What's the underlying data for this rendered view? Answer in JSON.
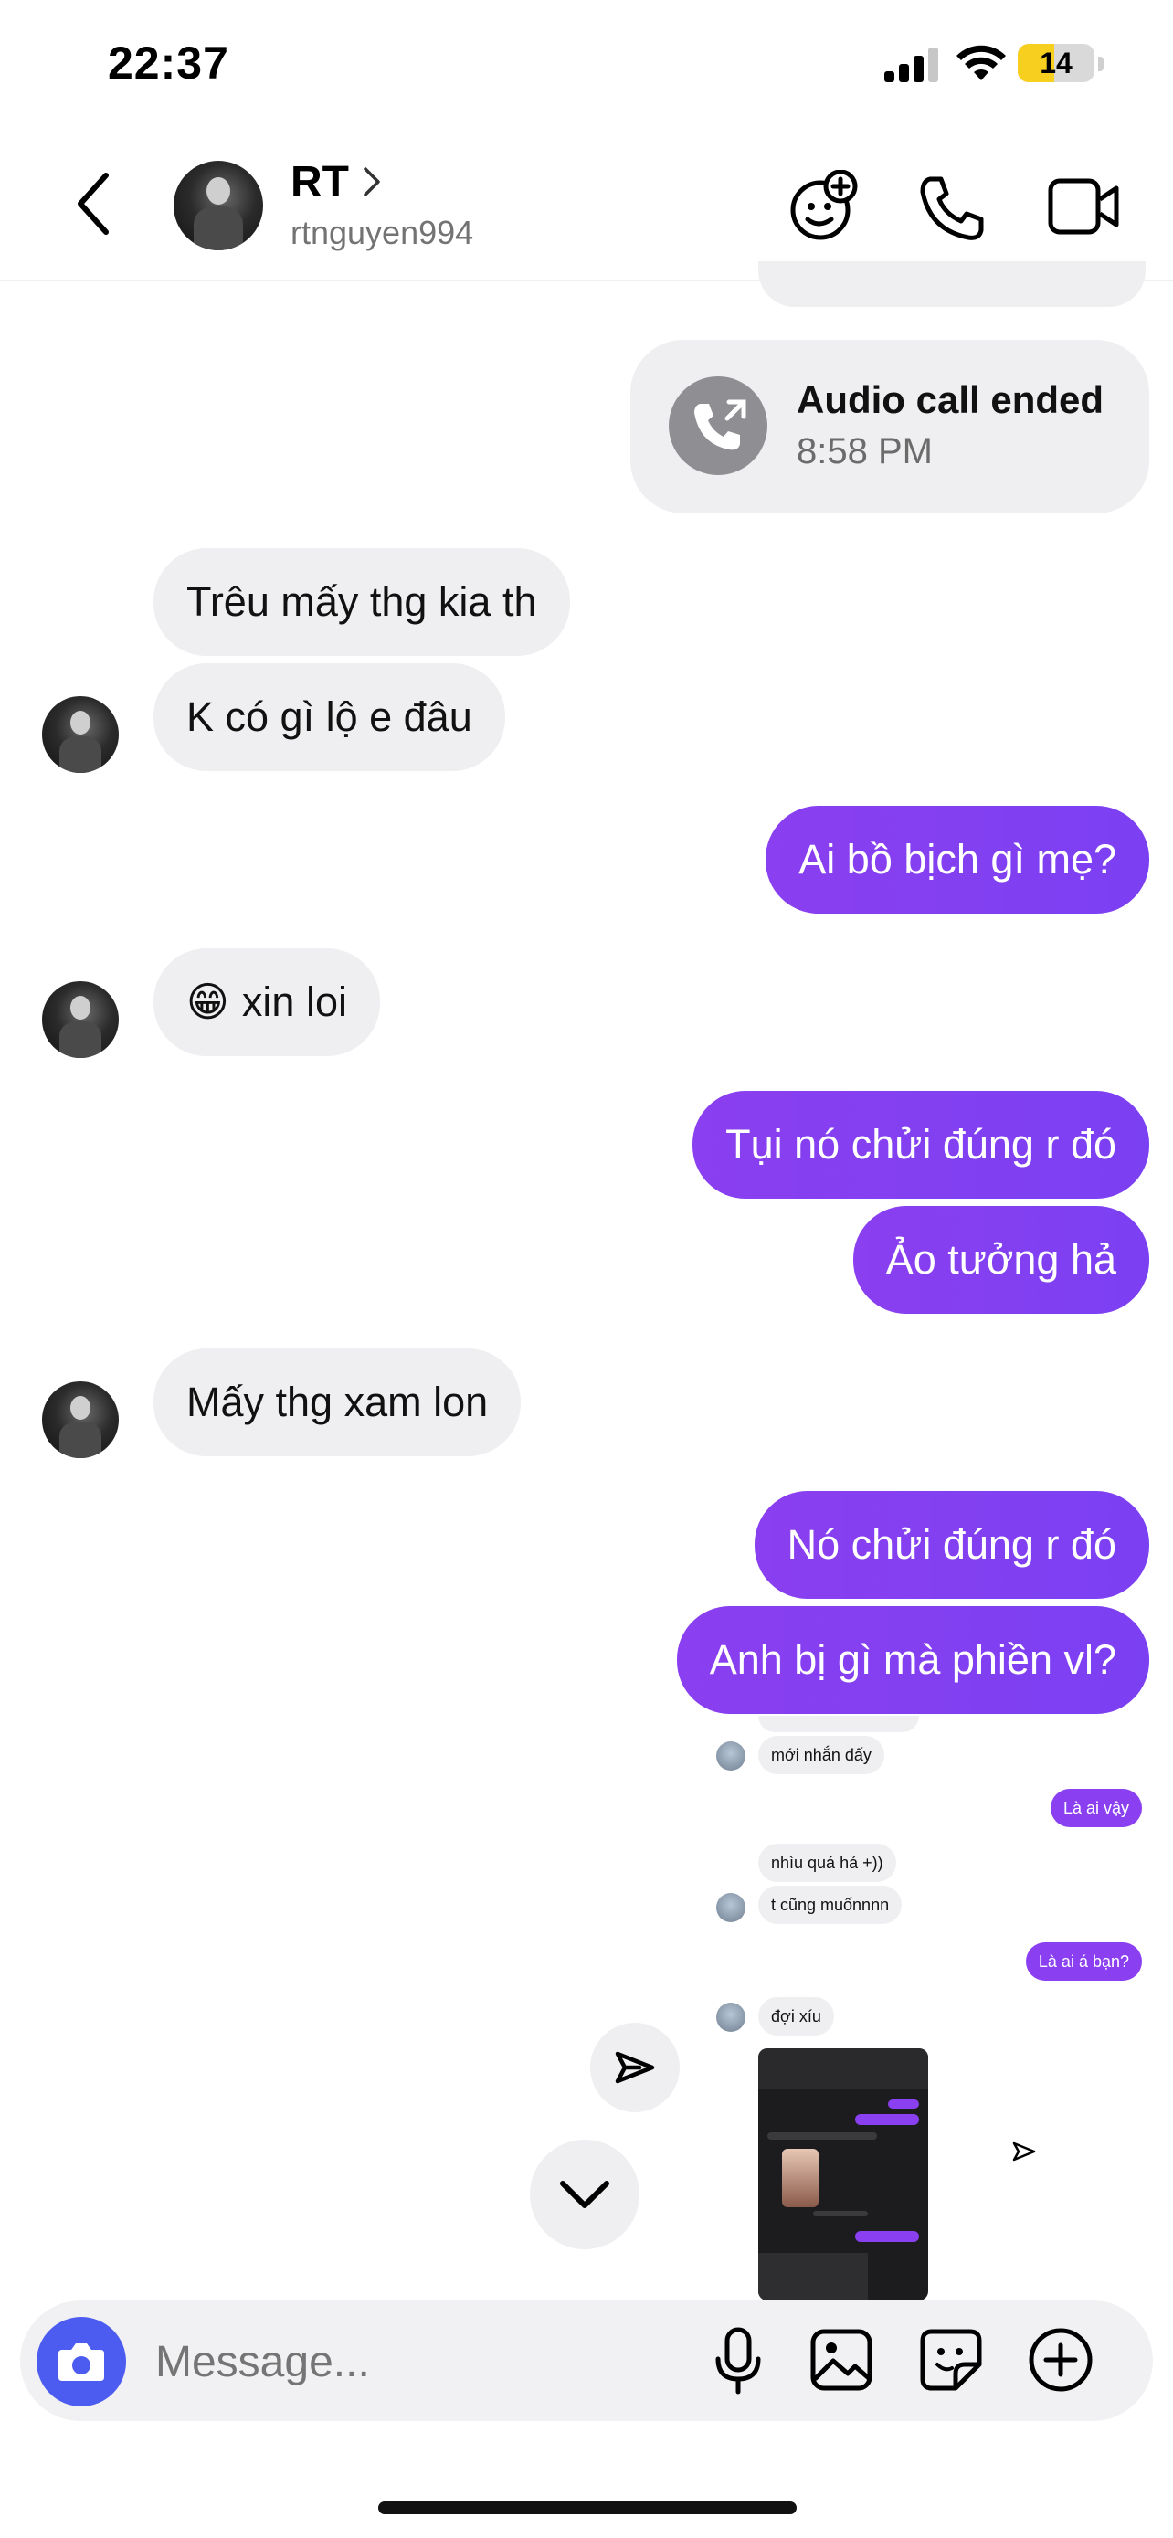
{
  "status_bar": {
    "time": "22:37",
    "battery": "14"
  },
  "header": {
    "name": "RT",
    "username": "rtnguyen994"
  },
  "call_card": {
    "title": "Audio call ended",
    "time": "8:58 PM"
  },
  "messages": [
    {
      "dir": "in",
      "text": "Trêu mấy thg kia th"
    },
    {
      "dir": "in",
      "text": "K có gì lộ e đâu"
    },
    {
      "dir": "out",
      "text": "Ai bồ bịch gì mẹ?"
    },
    {
      "dir": "in",
      "emoji": "😁",
      "text": "xin loi"
    },
    {
      "dir": "out",
      "text": "Tụi nó chửi đúng r đó"
    },
    {
      "dir": "out",
      "text": "Ảo tưởng hả"
    },
    {
      "dir": "in",
      "text": "Mấy thg xam lon"
    },
    {
      "dir": "out",
      "text": "Nó chửi đúng r đó"
    },
    {
      "dir": "out",
      "text": "Anh bị gì mà phiền vl?"
    }
  ],
  "shared_screenshot": {
    "items": [
      {
        "dir": "in",
        "text": "mới nhắn đấy"
      },
      {
        "dir": "out",
        "text": "Là ai vậy"
      },
      {
        "dir": "in",
        "text": "nhìu quá hả +))"
      },
      {
        "dir": "in",
        "text": "t cũng muốnnnn"
      },
      {
        "dir": "out",
        "text": "Là ai á bạn?"
      },
      {
        "dir": "in",
        "text": "đợi xíu"
      }
    ]
  },
  "composer": {
    "placeholder": "Message..."
  },
  "icons": {
    "back": "chevron-left-icon",
    "profile": "chevron-right-icon",
    "effects": "face-plus-icon",
    "call": "phone-icon",
    "video": "video-camera-icon",
    "share": "paper-plane-icon",
    "scroll_down": "chevron-down-icon",
    "camera": "camera-icon",
    "mic": "microphone-icon",
    "gallery": "image-icon",
    "sticker": "sticker-icon",
    "more": "plus-circle-icon"
  },
  "colors": {
    "outgoing_bubble": "#8a3ff0",
    "incoming_bubble": "#efeff1",
    "camera_button": "#4d5cf0"
  }
}
